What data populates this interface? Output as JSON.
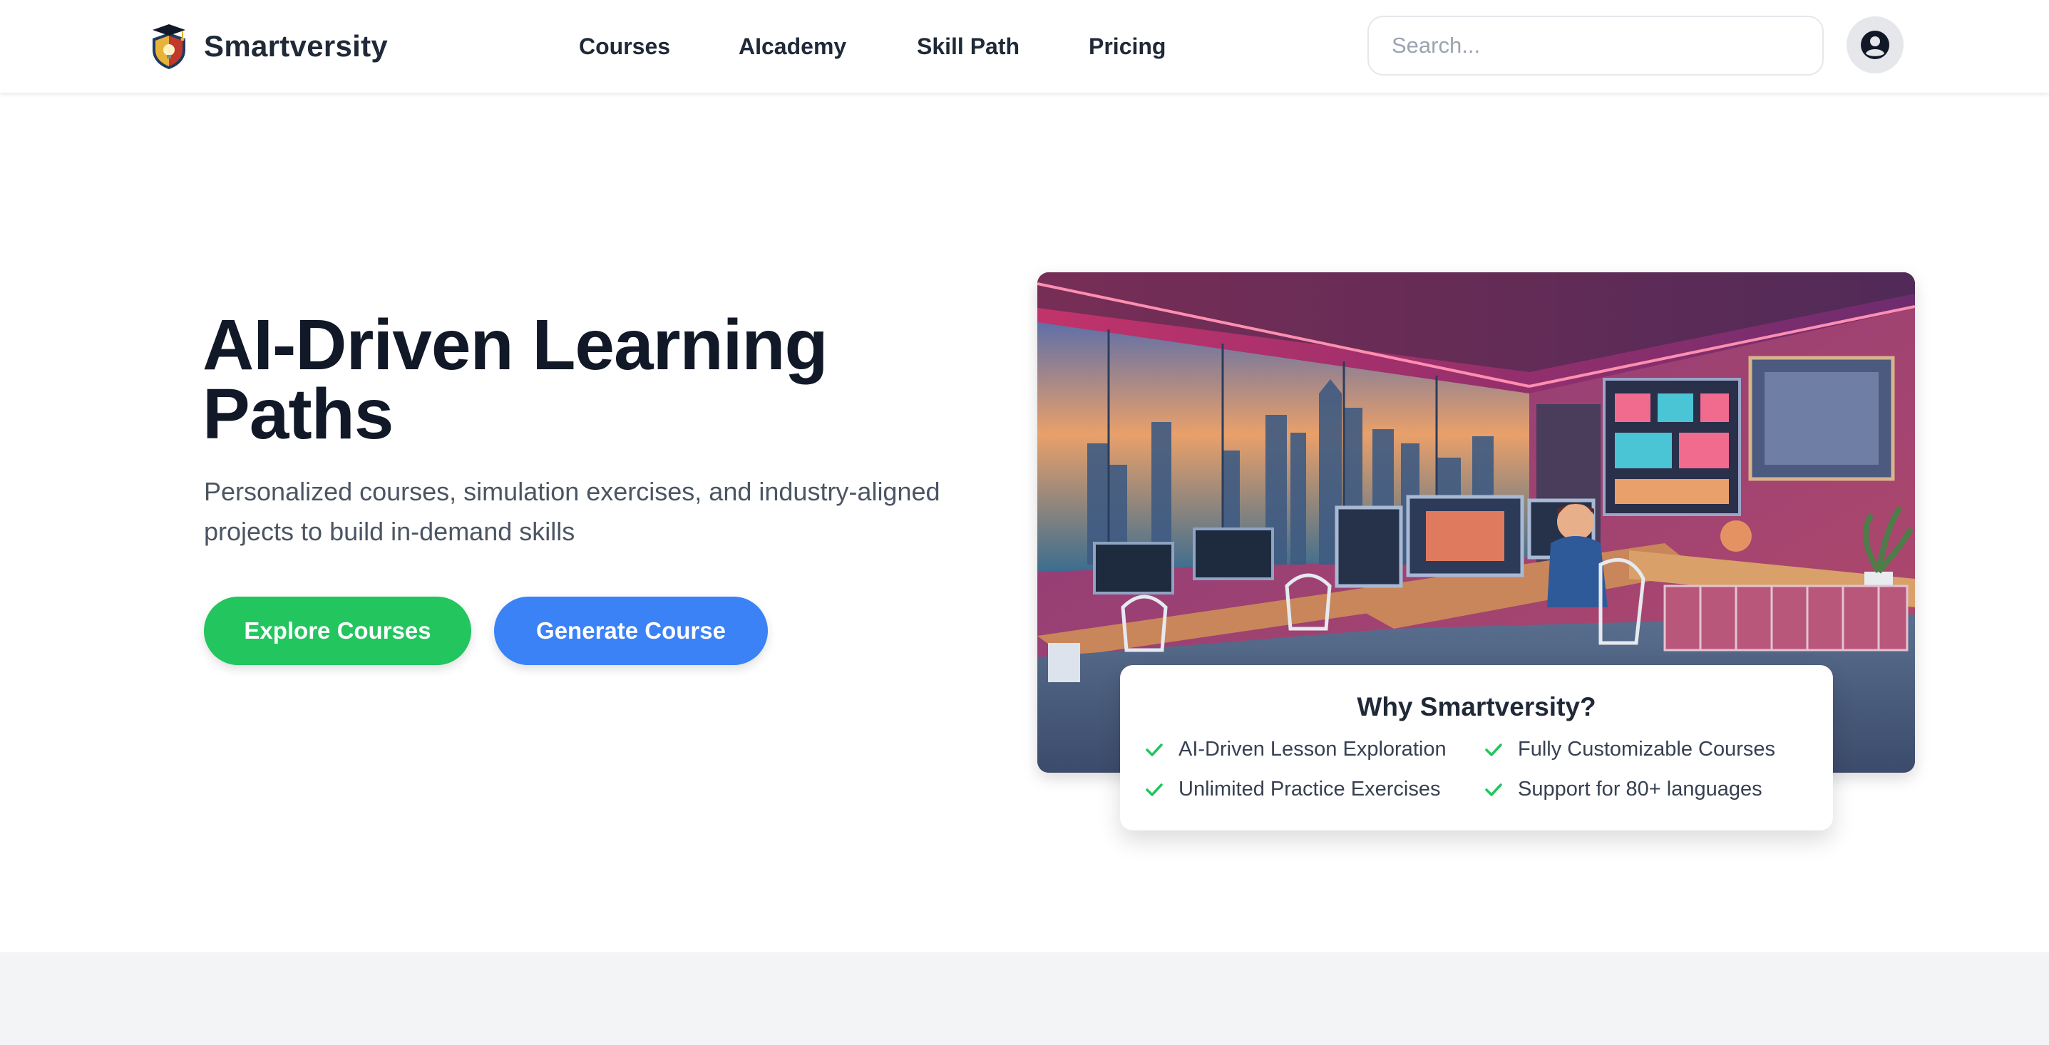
{
  "header": {
    "brand_name": "Smartversity",
    "logo_icon": "graduation-shield-icon",
    "nav": [
      {
        "label": "Courses"
      },
      {
        "label": "AIcademy"
      },
      {
        "label": "Skill Path"
      },
      {
        "label": "Pricing"
      }
    ],
    "search_placeholder": "Search...",
    "account_icon": "user-circle-icon"
  },
  "hero": {
    "title": "AI-Driven Learning Paths",
    "subtitle": "Personalized courses, simulation exercises, and industry-aligned projects to build in-demand skills",
    "primary_button": "Explore Courses",
    "secondary_button": "Generate Course",
    "image_icon": "ai-workspace-illustration"
  },
  "why": {
    "title": "Why Smartversity?",
    "features": [
      "AI-Driven Lesson Exploration",
      "Fully Customizable Courses",
      "Unlimited Practice Exercises",
      "Support for 80+ languages"
    ],
    "check_icon": "check-icon"
  },
  "colors": {
    "green": "#22c55e",
    "blue": "#3b82f6",
    "text_dark": "#111827",
    "text_muted": "#4b5563",
    "band": "#f3f4f6"
  }
}
